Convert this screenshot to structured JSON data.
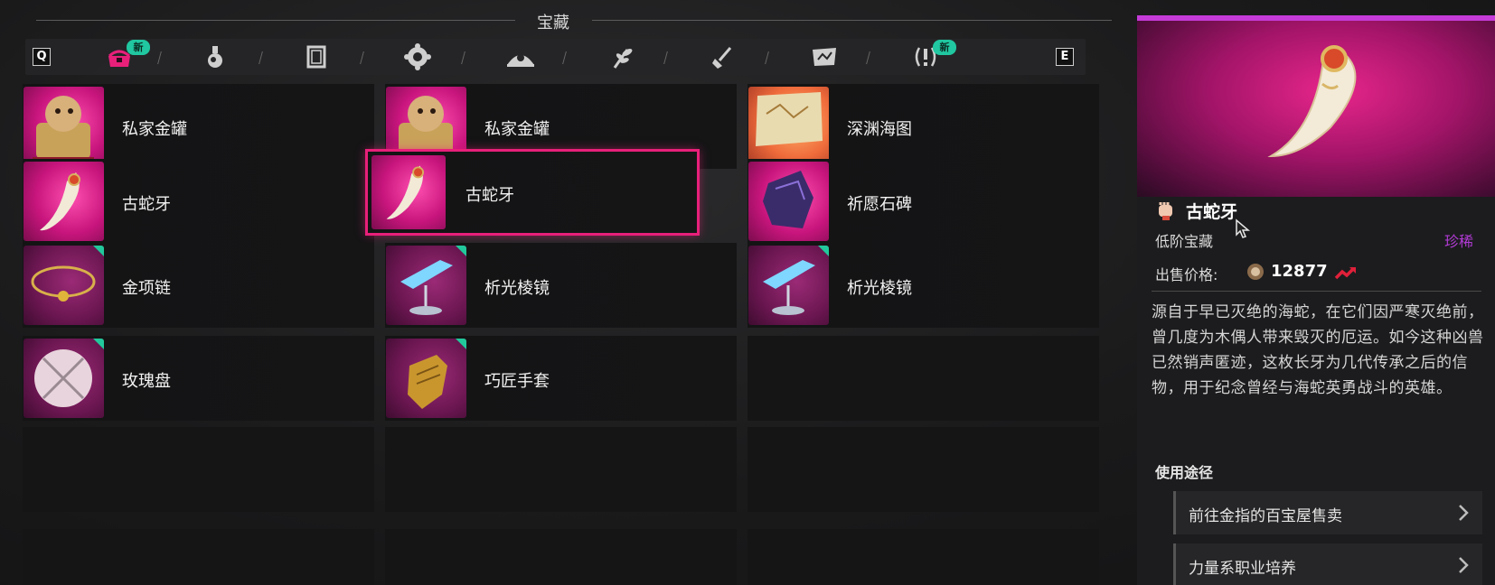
{
  "header": {
    "title": "宝藏"
  },
  "tabbar": {
    "left_key": "Q",
    "right_key": "E",
    "tabs": [
      {
        "icon": "treasure-chest-icon",
        "active": true,
        "new_badge": "新"
      },
      {
        "icon": "potion-icon"
      },
      {
        "icon": "scroll-icon"
      },
      {
        "icon": "gear-cog-icon"
      },
      {
        "icon": "crown-icon"
      },
      {
        "icon": "herb-icon"
      },
      {
        "icon": "shovel-icon"
      },
      {
        "icon": "map-icon"
      },
      {
        "icon": "quest-exclaim-icon",
        "new_badge": "新"
      }
    ],
    "colors": {
      "active": "#e8207a",
      "badge": "#20c7a0"
    }
  },
  "grid": {
    "rows": [
      [
        {
          "name": "私家金罐",
          "thumb": "hamster-jar"
        },
        {
          "name": "私家金罐",
          "thumb": "hamster-jar"
        },
        {
          "name": "深渊海图",
          "thumb": "sea-map",
          "tone": "gold"
        }
      ],
      [
        {
          "name": "古蛇牙",
          "thumb": "serpent-fang"
        },
        {
          "name": "古蛇牙",
          "thumb": "serpent-fang",
          "selected": true
        },
        {
          "name": "祈愿石碑",
          "thumb": "wish-stone"
        }
      ],
      [
        {
          "name": "金项链",
          "thumb": "gold-necklace",
          "new_corner": true
        },
        {
          "name": "析光棱镜",
          "thumb": "prism",
          "new_corner": true
        },
        {
          "name": "析光棱镜",
          "thumb": "prism",
          "new_corner": true
        }
      ],
      [
        {
          "name": "玫瑰盘",
          "thumb": "rose-plate",
          "new_corner": true
        },
        {
          "name": "巧匠手套",
          "thumb": "gauntlet",
          "new_corner": true
        },
        null
      ],
      [
        null,
        null,
        null
      ],
      [
        null,
        null,
        null
      ]
    ]
  },
  "detail": {
    "name": "古蛇牙",
    "tier": "低阶宝藏",
    "rarity": "珍稀",
    "price_label": "出售价格:",
    "price": "12877",
    "description": "源自于早已灭绝的海蛇，在它们因严寒灭绝前，曾几度为木偶人带来毁灭的厄运。如今这种凶兽已然销声匿迹，这枚长牙为几代传承之后的信物，用于纪念曾经与海蛇英勇战斗的英雄。",
    "usage_title": "使用途径",
    "usage": [
      "前往金指的百宝屋售卖",
      "力量系职业培养"
    ],
    "colors": {
      "rarity": "#b23bd6",
      "hero": "#e8268b"
    }
  }
}
